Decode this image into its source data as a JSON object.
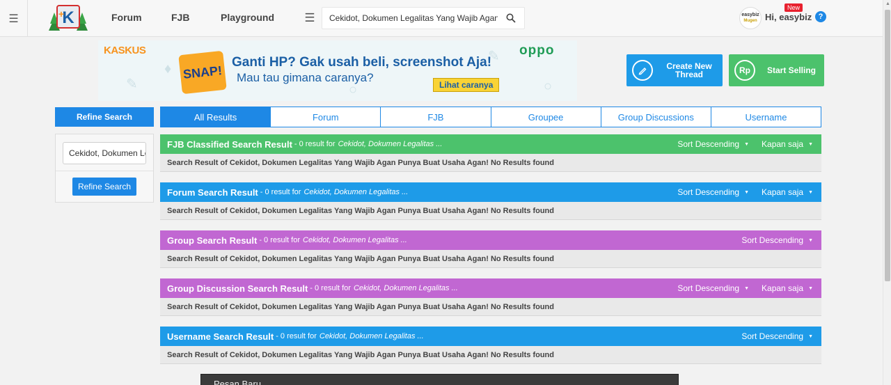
{
  "nav": {
    "forum": "Forum",
    "fjb": "FJB",
    "playground": "Playground",
    "search_value": "Cekidot, Dokumen Legalitas Yang Wajib Agan Punya Buat Usaha Agan!",
    "user_avatar_text": "easybiz",
    "user_avatar_sub": "Mugen",
    "greeting": "Hi, easybiz",
    "new_badge": "New",
    "help": "?"
  },
  "banner": {
    "kaskus_a": "KAS",
    "kaskus_b": "KUS",
    "snap": "SNAP!",
    "headline": "Ganti HP? Gak usah beli, screenshot Aja!",
    "subline": "Mau tau gimana caranya?",
    "cta": "Lihat caranya",
    "oppo": "oppo"
  },
  "actions": {
    "create_thread": "Create New Thread",
    "create_icon": "pencil-icon",
    "start_selling": "Start Selling",
    "sell_icon": "Rp"
  },
  "sidebar": {
    "title": "Refine Search",
    "input_value": "Cekidot, Dokumen Legalitas Yang Wajib Agan Punya Buat Usaha Agan!",
    "button": "Refine Search"
  },
  "tabs": [
    "All Results",
    "Forum",
    "FJB",
    "Groupee",
    "Group Discussions",
    "Username"
  ],
  "results": [
    {
      "title": "FJB Classified Search Result",
      "count_text": "- 0 result for",
      "query": "Cekidot, Dokumen Legalitas ...",
      "sort": "Sort Descending",
      "time": "Kapan saja",
      "body": "Search Result of Cekidot, Dokumen Legalitas Yang Wajib Agan Punya Buat Usaha Agan! No Results found",
      "color": "#4cc26c"
    },
    {
      "title": "Forum Search Result",
      "count_text": "- 0 result for",
      "query": "Cekidot, Dokumen Legalitas ...",
      "sort": "Sort Descending",
      "time": "Kapan saja",
      "body": "Search Result of Cekidot, Dokumen Legalitas Yang Wajib Agan Punya Buat Usaha Agan! No Results found",
      "color": "#1e9be8"
    },
    {
      "title": "Group Search Result",
      "count_text": "- 0 result for",
      "query": "Cekidot, Dokumen Legalitas ...",
      "sort": "Sort Descending",
      "body": "Search Result of Cekidot, Dokumen Legalitas Yang Wajib Agan Punya Buat Usaha Agan! No Results found",
      "color": "#c167d2"
    },
    {
      "title": "Group Discussion Search Result",
      "count_text": "- 0 result for",
      "query": "Cekidot, Dokumen Legalitas ...",
      "sort": "Sort Descending",
      "time": "Kapan saja",
      "body": "Search Result of Cekidot, Dokumen Legalitas Yang Wajib Agan Punya Buat Usaha Agan! No Results found",
      "color": "#c167d2"
    },
    {
      "title": "Username Search Result",
      "count_text": "- 0 result for",
      "query": "Cekidot, Dokumen Legalitas ...",
      "sort": "Sort Descending",
      "body": "Search Result of Cekidot, Dokumen Legalitas Yang Wajib Agan Punya Buat Usaha Agan! No Results found",
      "color": "#1e9be8"
    }
  ],
  "popup": {
    "title": "Pesan Baru"
  }
}
